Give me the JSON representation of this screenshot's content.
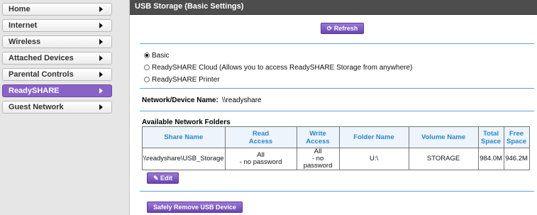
{
  "nav": {
    "items": [
      {
        "label": "Home",
        "active": false
      },
      {
        "label": "Internet",
        "active": false
      },
      {
        "label": "Wireless",
        "active": false
      },
      {
        "label": "Attached Devices",
        "active": false
      },
      {
        "label": "Parental Controls",
        "active": false
      },
      {
        "label": "ReadySHARE",
        "active": true
      },
      {
        "label": "Guest Network",
        "active": false
      }
    ]
  },
  "header": {
    "title": "USB Storage (Basic Settings)"
  },
  "refresh_button": {
    "label": "Refresh",
    "icon": "refresh-icon"
  },
  "mode_options": [
    {
      "label": "Basic",
      "checked": true
    },
    {
      "label": "ReadySHARE Cloud (Allows you to access ReadySHARE Storage from anywhere)",
      "checked": false
    },
    {
      "label": "ReadySHARE Printer",
      "checked": false
    }
  ],
  "device": {
    "label": "Network/Device Name:",
    "value": "\\\\readyshare"
  },
  "folders": {
    "title": "Available Network Folders",
    "columns": [
      [
        "Share Name"
      ],
      [
        "Read",
        "Access"
      ],
      [
        "Write",
        "Access"
      ],
      [
        "Folder Name"
      ],
      [
        "Volume Name"
      ],
      [
        "Total",
        "Space"
      ],
      [
        "Free",
        "Space"
      ]
    ],
    "rows": [
      {
        "share_name": "\\\\readyshare\\USB_Storage",
        "read_access": [
          "All",
          "- no password"
        ],
        "write_access": [
          "All",
          "- no password"
        ],
        "folder_name": "U:\\",
        "volume_name": "STORAGE",
        "total_space": "984.0M",
        "free_space": "946.2M"
      }
    ]
  },
  "edit_button": {
    "label": "Edit",
    "icon": "pencil-icon"
  },
  "remove_button": {
    "label": "Safely Remove USB Device"
  },
  "colors": {
    "accent": "#8a63c7",
    "header_bg": "#4d4d4d",
    "rule": "#5fa3d6",
    "table_header_text": "#2a86c9"
  }
}
